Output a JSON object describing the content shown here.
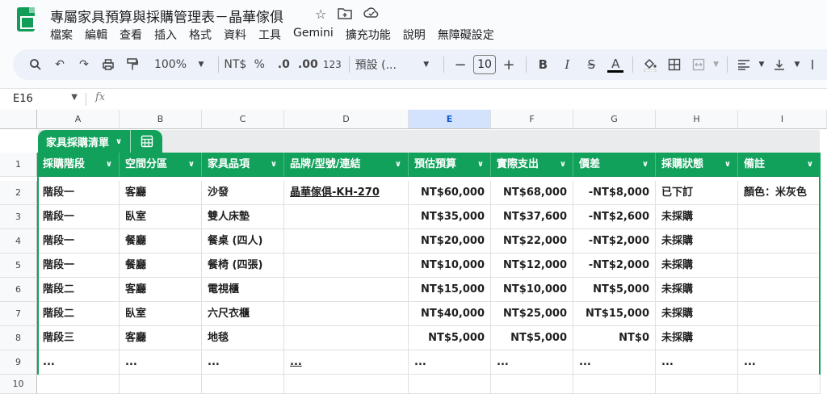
{
  "doc": {
    "title": "專屬家具預算與採購管理表－晶華傢俱",
    "menu": [
      "檔案",
      "編輯",
      "查看",
      "插入",
      "格式",
      "資料",
      "工具",
      "Gemini",
      "擴充功能",
      "說明",
      "無障礙設定"
    ]
  },
  "toolbar": {
    "zoom": "100%",
    "currency": "NT$",
    "percent": "%",
    "dec_decrease": ".0",
    "dec_increase": ".00",
    "number_format": "123",
    "font": "預設 (...",
    "font_size": "10",
    "bold": "B",
    "italic": "I",
    "strike": "S",
    "text_color": "A"
  },
  "formula_bar": {
    "cell_ref": "E16",
    "fx": "fx"
  },
  "columns": [
    "A",
    "B",
    "C",
    "D",
    "E",
    "F",
    "G",
    "H",
    "I"
  ],
  "selected_column": "E",
  "rows": [
    "1",
    "2",
    "3",
    "4",
    "5",
    "6",
    "7",
    "8",
    "9",
    "10"
  ],
  "table": {
    "name": "家具採購清單",
    "headers": [
      "採購階段",
      "空間分區",
      "家具品項",
      "品牌/型號/連結",
      "預估預算",
      "實際支出",
      "價差",
      "採購狀態",
      "備註"
    ],
    "data": [
      [
        "階段一",
        "客廳",
        "沙發",
        "晶華傢俱-KH-270",
        "NT$60,000",
        "NT$68,000",
        "-NT$8,000",
        "已下訂",
        "顏色：米灰色"
      ],
      [
        "階段一",
        "臥室",
        "雙人床墊",
        "",
        "NT$35,000",
        "NT$37,600",
        "-NT$2,600",
        "未採購",
        ""
      ],
      [
        "階段一",
        "餐廳",
        "餐桌 (四人)",
        "",
        "NT$20,000",
        "NT$22,000",
        "-NT$2,000",
        "未採購",
        ""
      ],
      [
        "階段一",
        "餐廳",
        "餐椅 (四張)",
        "",
        "NT$10,000",
        "NT$12,000",
        "-NT$2,000",
        "未採購",
        ""
      ],
      [
        "階段二",
        "客廳",
        "電視櫃",
        "",
        "NT$15,000",
        "NT$10,000",
        "NT$5,000",
        "未採購",
        ""
      ],
      [
        "階段二",
        "臥室",
        "六尺衣櫃",
        "",
        "NT$40,000",
        "NT$25,000",
        "NT$15,000",
        "未採購",
        ""
      ],
      [
        "階段三",
        "客廳",
        "地毯",
        "",
        "NT$5,000",
        "NT$5,000",
        "NT$0",
        "未採購",
        ""
      ],
      [
        "...",
        "...",
        "...",
        "...",
        "...",
        "...",
        "...",
        "...",
        "..."
      ]
    ]
  },
  "colors": {
    "table_green": "#12a15b",
    "selected_col": "#d3e3fd"
  }
}
